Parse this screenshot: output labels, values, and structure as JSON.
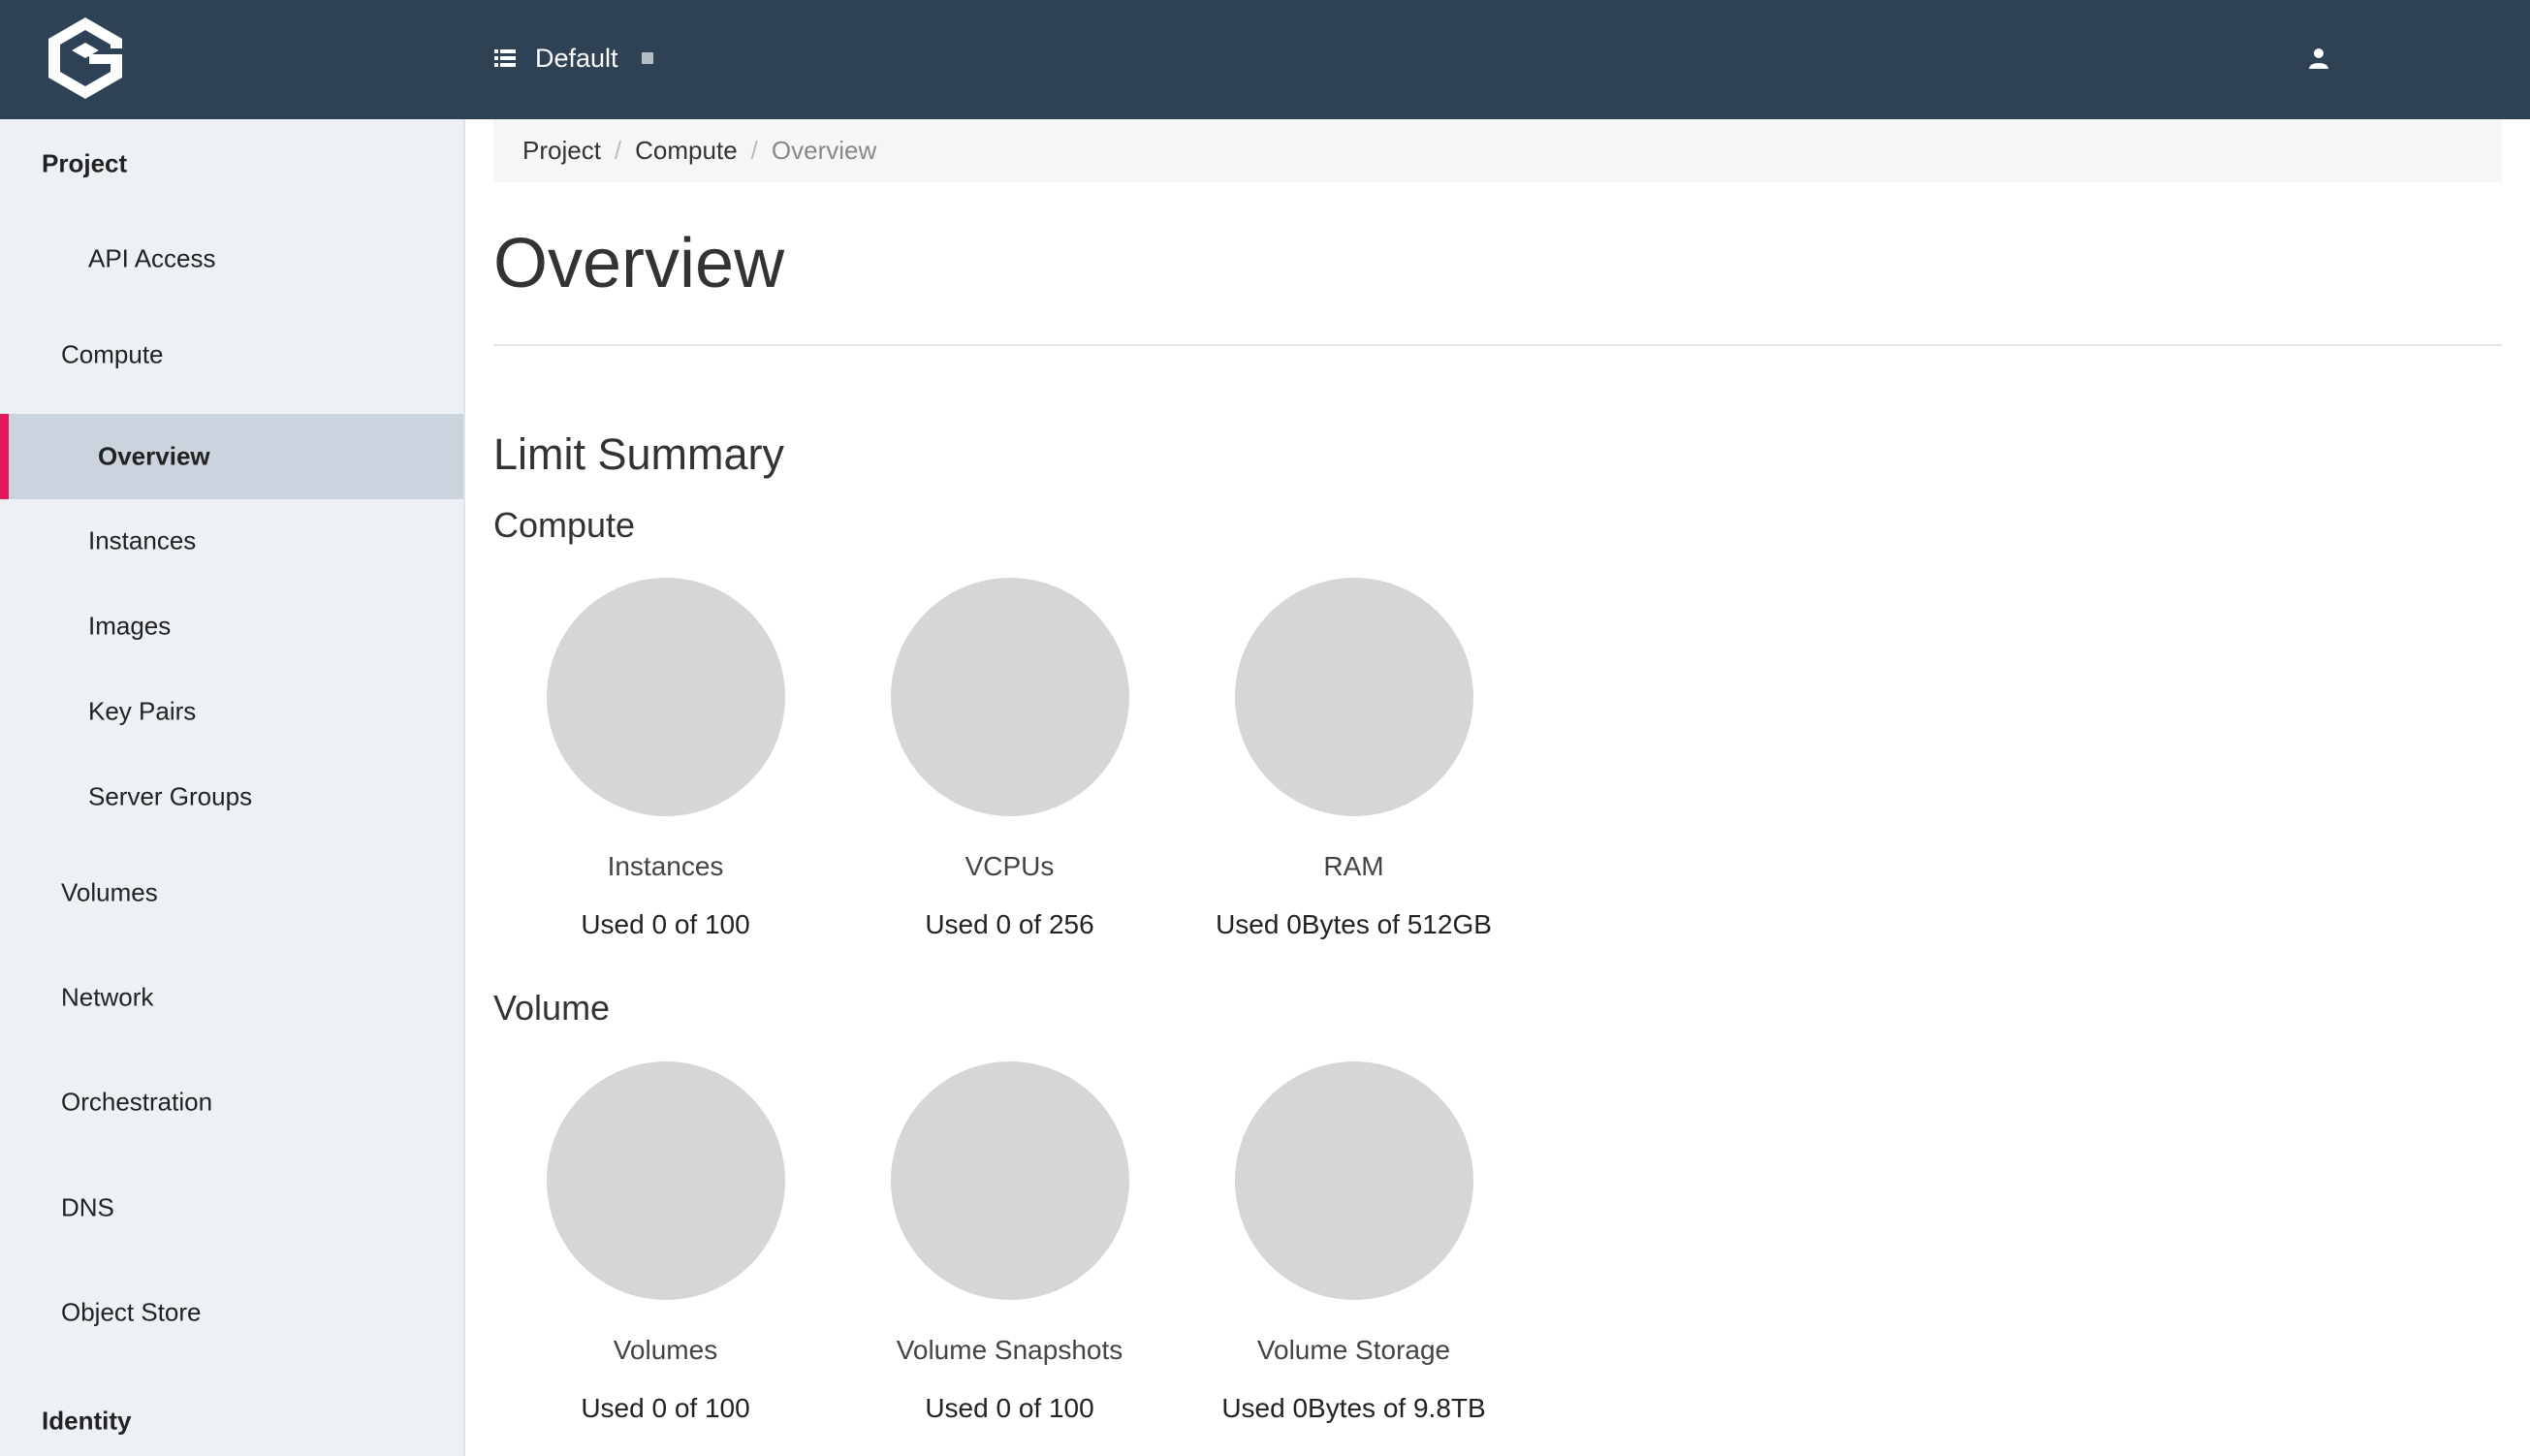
{
  "header": {
    "project_name": "Default"
  },
  "sidebar": {
    "items": [
      {
        "label": "Project",
        "kind": "heading"
      },
      {
        "label": "API Access",
        "kind": "sub"
      },
      {
        "label": "Compute",
        "kind": "group"
      },
      {
        "label": "Overview",
        "kind": "sub",
        "active": true
      },
      {
        "label": "Instances",
        "kind": "sub"
      },
      {
        "label": "Images",
        "kind": "sub"
      },
      {
        "label": "Key Pairs",
        "kind": "sub"
      },
      {
        "label": "Server Groups",
        "kind": "sub"
      },
      {
        "label": "Volumes",
        "kind": "group"
      },
      {
        "label": "Network",
        "kind": "group"
      },
      {
        "label": "Orchestration",
        "kind": "group"
      },
      {
        "label": "DNS",
        "kind": "group"
      },
      {
        "label": "Object Store",
        "kind": "group"
      },
      {
        "label": "Identity",
        "kind": "heading"
      }
    ]
  },
  "breadcrumb": {
    "items": [
      "Project",
      "Compute",
      "Overview"
    ]
  },
  "page": {
    "title": "Overview",
    "section_title": "Limit Summary"
  },
  "groups": [
    {
      "title": "Compute",
      "charts": [
        {
          "label": "Instances",
          "usage": "Used 0 of 100"
        },
        {
          "label": "VCPUs",
          "usage": "Used 0 of 256"
        },
        {
          "label": "RAM",
          "usage": "Used 0Bytes of 512GB"
        }
      ]
    },
    {
      "title": "Volume",
      "charts": [
        {
          "label": "Volumes",
          "usage": "Used 0 of 100"
        },
        {
          "label": "Volume Snapshots",
          "usage": "Used 0 of 100"
        },
        {
          "label": "Volume Storage",
          "usage": "Used 0Bytes of 9.8TB"
        }
      ]
    }
  ],
  "colors": {
    "topbar": "#2f4155",
    "sidebar": "#edf1f5",
    "active_item": "#cbd3dc",
    "active_marker": "#e4195a",
    "pie": "#d6d6d6"
  }
}
